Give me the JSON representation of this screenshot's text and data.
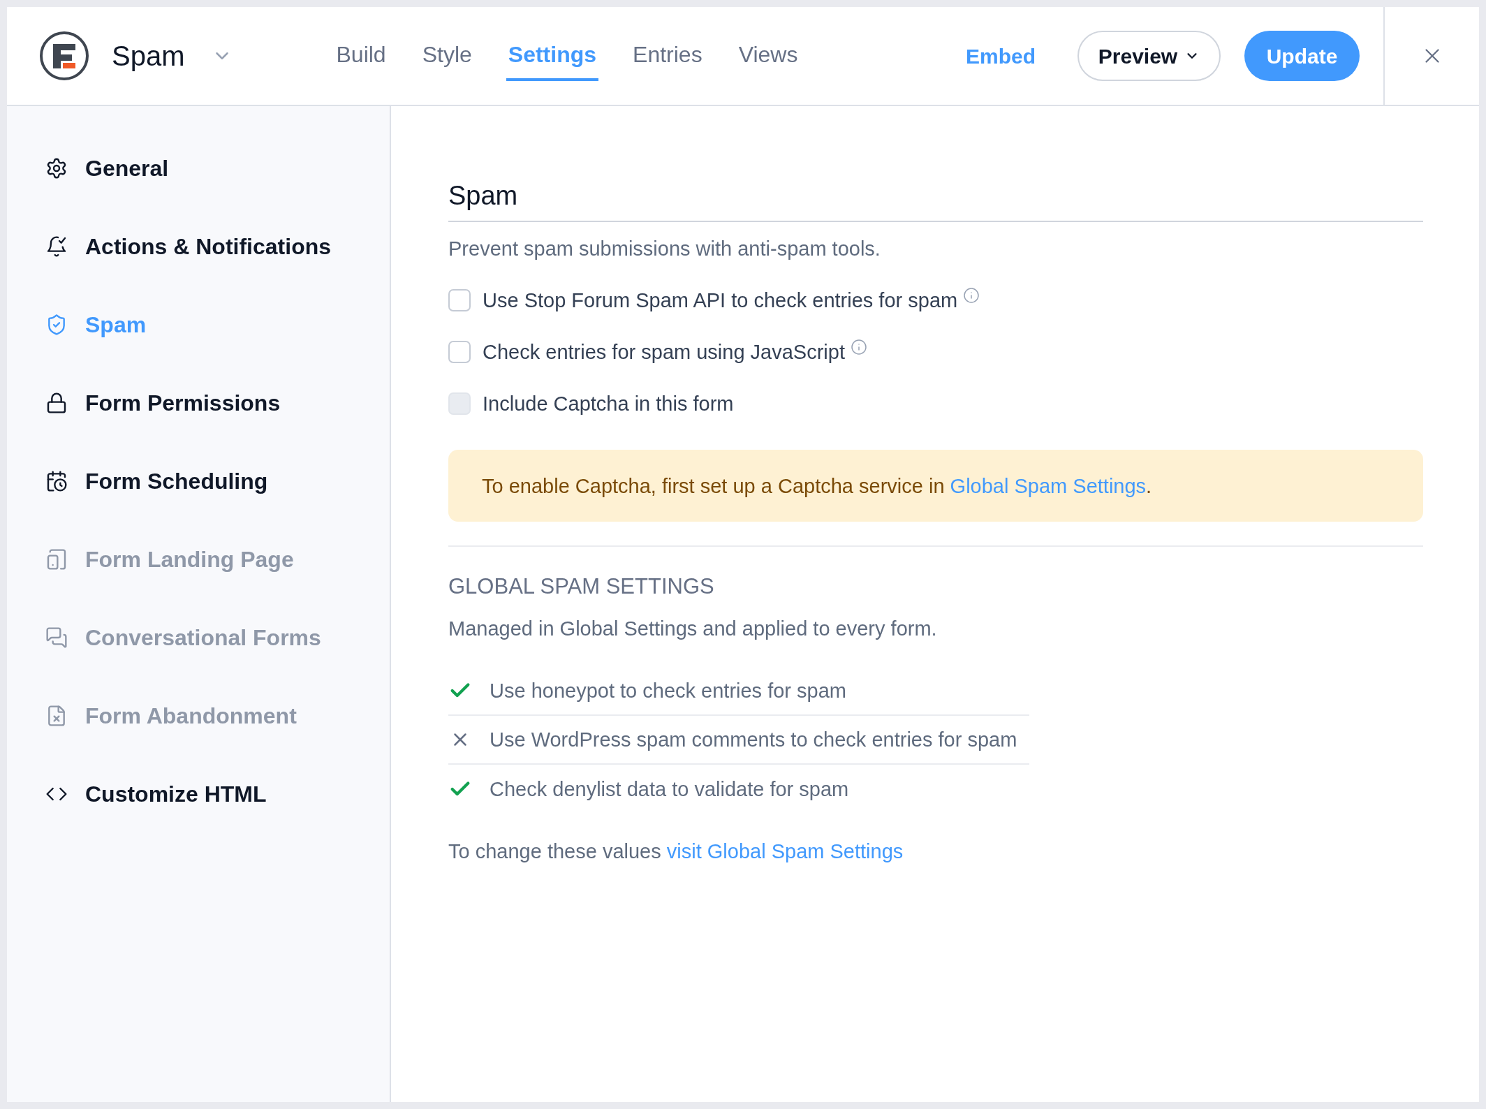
{
  "header": {
    "title": "Spam",
    "tabs": [
      {
        "label": "Build",
        "selected": false
      },
      {
        "label": "Style",
        "selected": false
      },
      {
        "label": "Settings",
        "selected": true
      },
      {
        "label": "Entries",
        "selected": false
      },
      {
        "label": "Views",
        "selected": false
      }
    ],
    "embed": "Embed",
    "preview": "Preview",
    "update": "Update"
  },
  "sidebar": {
    "items": [
      {
        "label": "General",
        "selected": false,
        "disabled": false
      },
      {
        "label": "Actions & Notifications",
        "selected": false,
        "disabled": false
      },
      {
        "label": "Spam",
        "selected": true,
        "disabled": false
      },
      {
        "label": "Form Permissions",
        "selected": false,
        "disabled": false
      },
      {
        "label": "Form Scheduling",
        "selected": false,
        "disabled": false
      },
      {
        "label": "Form Landing Page",
        "selected": false,
        "disabled": true
      },
      {
        "label": "Conversational Forms",
        "selected": false,
        "disabled": true
      },
      {
        "label": "Form Abandonment",
        "selected": false,
        "disabled": true
      },
      {
        "label": "Customize HTML",
        "selected": false,
        "disabled": false
      }
    ]
  },
  "section": {
    "title": "Spam",
    "description": "Prevent spam submissions with anti-spam tools.",
    "options": [
      {
        "label": "Use Stop Forum Spam API to check entries for spam",
        "checked": false,
        "disabled": false,
        "info": true
      },
      {
        "label": "Check entries for spam using JavaScript",
        "checked": false,
        "disabled": false,
        "info": true
      },
      {
        "label": "Include Captcha in this form",
        "checked": false,
        "disabled": true,
        "info": false
      }
    ],
    "notice": {
      "text": "To enable Captcha, first set up a Captcha service in",
      "link": "Global Spam Settings",
      "end": "."
    }
  },
  "global": {
    "title": "GLOBAL SPAM SETTINGS",
    "description": "Managed in Global Settings and applied to every form.",
    "items": [
      {
        "label": "Use honeypot to check entries for spam",
        "enabled": true
      },
      {
        "label": "Use WordPress spam comments to check entries for spam",
        "enabled": false
      },
      {
        "label": "Check denylist data to validate for spam",
        "enabled": true
      }
    ],
    "footer": {
      "text": "To change these values",
      "link": "visit Global Spam Settings"
    }
  }
}
